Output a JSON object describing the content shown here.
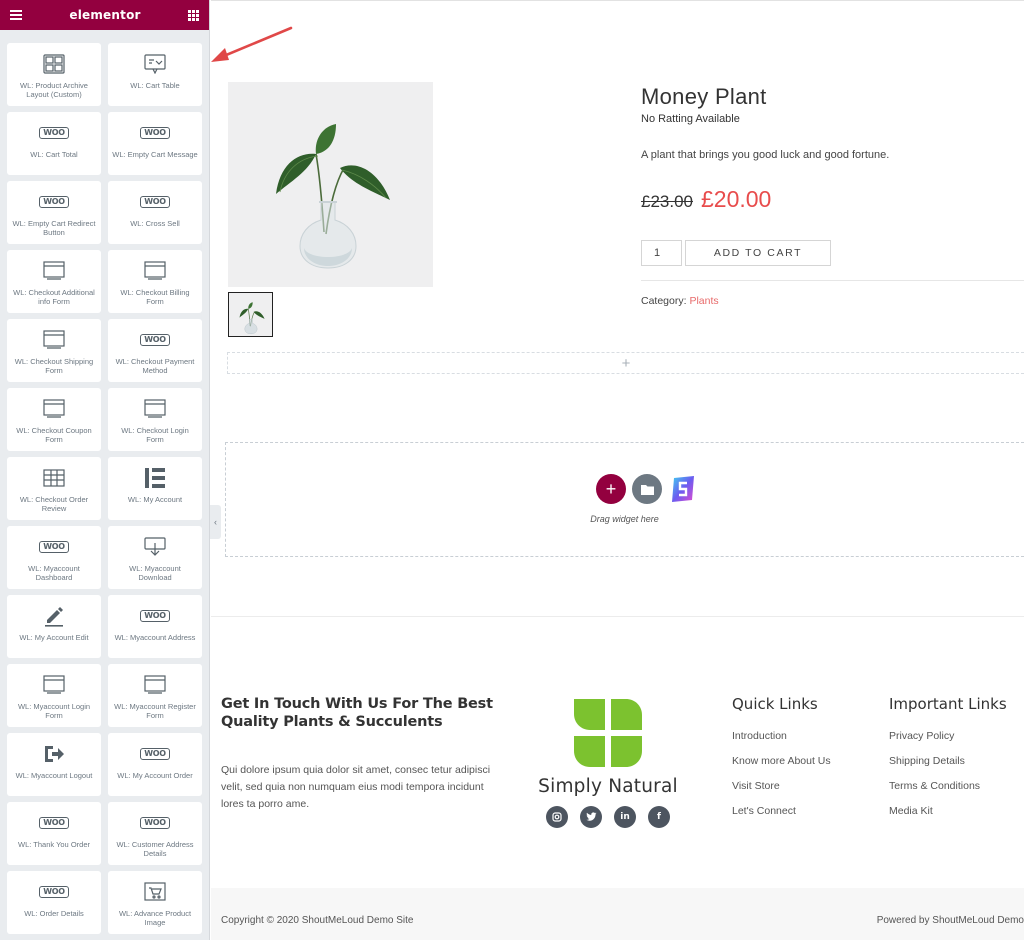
{
  "sidebar": {
    "brand": "elementor",
    "widgets": [
      {
        "label": "WL: Product Archive Layout (Custom)",
        "icon": "archive-layout-icon"
      },
      {
        "label": "WL: Cart Table",
        "icon": "cart-table-icon"
      },
      {
        "label": "WL: Cart Total",
        "icon": "woo-icon"
      },
      {
        "label": "WL: Empty Cart Message",
        "icon": "woo-icon"
      },
      {
        "label": "WL: Empty Cart Redirect Button",
        "icon": "woo-icon"
      },
      {
        "label": "WL: Cross Sell",
        "icon": "woo-icon"
      },
      {
        "label": "WL: Checkout Additional info Form",
        "icon": "form-icon"
      },
      {
        "label": "WL: Checkout Billing Form",
        "icon": "form-icon"
      },
      {
        "label": "WL: Checkout Shipping Form",
        "icon": "form-icon"
      },
      {
        "label": "WL: Checkout Payment Method",
        "icon": "woo-icon"
      },
      {
        "label": "WL: Checkout Coupon Form",
        "icon": "form-icon"
      },
      {
        "label": "WL: Checkout Login Form",
        "icon": "form-icon"
      },
      {
        "label": "WL: Checkout Order Review",
        "icon": "table-icon"
      },
      {
        "label": "WL: My Account",
        "icon": "elementor-icon"
      },
      {
        "label": "WL: Myaccount Dashboard",
        "icon": "woo-icon"
      },
      {
        "label": "WL: Myaccount Download",
        "icon": "download-icon"
      },
      {
        "label": "WL: My Account Edit",
        "icon": "pencil-icon"
      },
      {
        "label": "WL: Myaccount Address",
        "icon": "woo-icon"
      },
      {
        "label": "WL: Myaccount Login Form",
        "icon": "form-icon"
      },
      {
        "label": "WL: Myaccount Register Form",
        "icon": "form-icon"
      },
      {
        "label": "WL: Myaccount Logout",
        "icon": "logout-icon"
      },
      {
        "label": "WL: My Account Order",
        "icon": "woo-icon"
      },
      {
        "label": "WL: Thank You Order",
        "icon": "woo-icon"
      },
      {
        "label": "WL: Customer Address Details",
        "icon": "woo-icon"
      },
      {
        "label": "WL: Order Details",
        "icon": "woo-icon"
      },
      {
        "label": "WL: Advance Product Image",
        "icon": "product-image-icon"
      }
    ]
  },
  "product": {
    "title": "Money Plant",
    "rating_text": "No Ratting Available",
    "description": "A plant that brings you good luck and good fortune.",
    "old_price": "£23.00",
    "new_price": "£20.00",
    "quantity": "1",
    "add_to_cart_label": "ADD TO CART",
    "category_label": "Category:",
    "category_value": "Plants"
  },
  "editor": {
    "add_section_symbol": "+",
    "drag_text": "Drag widget here"
  },
  "footer": {
    "heading": "Get In Touch With Us For The Best Quality Plants & Succulents",
    "text": "Qui dolore ipsum quia dolor sit amet, consec tetur adipisci velit, sed quia non numquam eius modi tempora incidunt lores ta porro ame.",
    "brand_name": "Simply Natural",
    "quick_links": {
      "title": "Quick Links",
      "items": [
        "Introduction",
        "Know more About Us",
        "Visit Store",
        "Let's Connect"
      ]
    },
    "important_links": {
      "title": "Important Links",
      "items": [
        "Privacy Policy",
        "Shipping Details",
        "Terms & Conditions",
        "Media Kit"
      ]
    },
    "copyright": "Copyright © 2020 ShoutMeLoud Demo Site",
    "powered": "Powered by ShoutMeLoud Demo"
  },
  "colors": {
    "elementor_header": "#93003f",
    "sale_price": "#e84c4c",
    "category_link": "#e86a6a",
    "logo_green": "#7cc22f",
    "arrow": "#e04848"
  }
}
